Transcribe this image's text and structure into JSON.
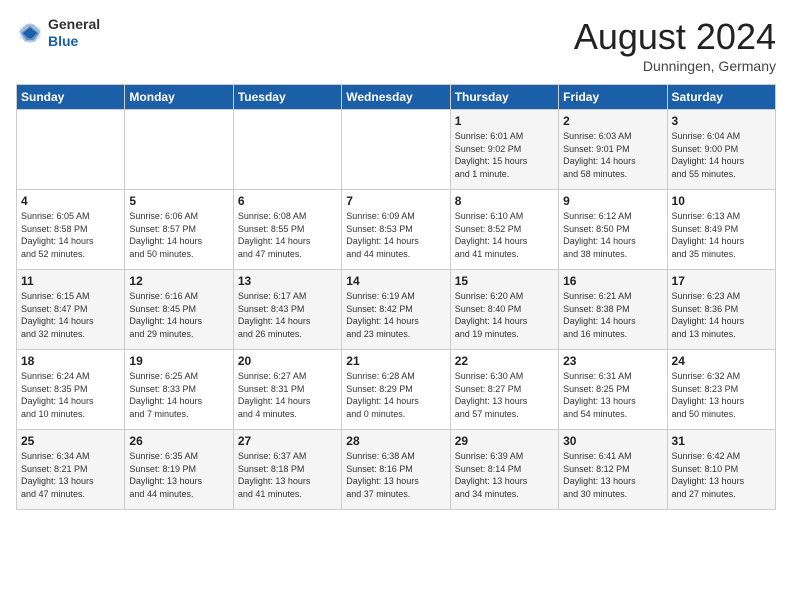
{
  "header": {
    "logo_general": "General",
    "logo_blue": "Blue",
    "title": "August 2024",
    "subtitle": "Dunningen, Germany"
  },
  "weekdays": [
    "Sunday",
    "Monday",
    "Tuesday",
    "Wednesday",
    "Thursday",
    "Friday",
    "Saturday"
  ],
  "weeks": [
    [
      {
        "day": "",
        "info": ""
      },
      {
        "day": "",
        "info": ""
      },
      {
        "day": "",
        "info": ""
      },
      {
        "day": "",
        "info": ""
      },
      {
        "day": "1",
        "info": "Sunrise: 6:01 AM\nSunset: 9:02 PM\nDaylight: 15 hours\nand 1 minute."
      },
      {
        "day": "2",
        "info": "Sunrise: 6:03 AM\nSunset: 9:01 PM\nDaylight: 14 hours\nand 58 minutes."
      },
      {
        "day": "3",
        "info": "Sunrise: 6:04 AM\nSunset: 9:00 PM\nDaylight: 14 hours\nand 55 minutes."
      }
    ],
    [
      {
        "day": "4",
        "info": "Sunrise: 6:05 AM\nSunset: 8:58 PM\nDaylight: 14 hours\nand 52 minutes."
      },
      {
        "day": "5",
        "info": "Sunrise: 6:06 AM\nSunset: 8:57 PM\nDaylight: 14 hours\nand 50 minutes."
      },
      {
        "day": "6",
        "info": "Sunrise: 6:08 AM\nSunset: 8:55 PM\nDaylight: 14 hours\nand 47 minutes."
      },
      {
        "day": "7",
        "info": "Sunrise: 6:09 AM\nSunset: 8:53 PM\nDaylight: 14 hours\nand 44 minutes."
      },
      {
        "day": "8",
        "info": "Sunrise: 6:10 AM\nSunset: 8:52 PM\nDaylight: 14 hours\nand 41 minutes."
      },
      {
        "day": "9",
        "info": "Sunrise: 6:12 AM\nSunset: 8:50 PM\nDaylight: 14 hours\nand 38 minutes."
      },
      {
        "day": "10",
        "info": "Sunrise: 6:13 AM\nSunset: 8:49 PM\nDaylight: 14 hours\nand 35 minutes."
      }
    ],
    [
      {
        "day": "11",
        "info": "Sunrise: 6:15 AM\nSunset: 8:47 PM\nDaylight: 14 hours\nand 32 minutes."
      },
      {
        "day": "12",
        "info": "Sunrise: 6:16 AM\nSunset: 8:45 PM\nDaylight: 14 hours\nand 29 minutes."
      },
      {
        "day": "13",
        "info": "Sunrise: 6:17 AM\nSunset: 8:43 PM\nDaylight: 14 hours\nand 26 minutes."
      },
      {
        "day": "14",
        "info": "Sunrise: 6:19 AM\nSunset: 8:42 PM\nDaylight: 14 hours\nand 23 minutes."
      },
      {
        "day": "15",
        "info": "Sunrise: 6:20 AM\nSunset: 8:40 PM\nDaylight: 14 hours\nand 19 minutes."
      },
      {
        "day": "16",
        "info": "Sunrise: 6:21 AM\nSunset: 8:38 PM\nDaylight: 14 hours\nand 16 minutes."
      },
      {
        "day": "17",
        "info": "Sunrise: 6:23 AM\nSunset: 8:36 PM\nDaylight: 14 hours\nand 13 minutes."
      }
    ],
    [
      {
        "day": "18",
        "info": "Sunrise: 6:24 AM\nSunset: 8:35 PM\nDaylight: 14 hours\nand 10 minutes."
      },
      {
        "day": "19",
        "info": "Sunrise: 6:25 AM\nSunset: 8:33 PM\nDaylight: 14 hours\nand 7 minutes."
      },
      {
        "day": "20",
        "info": "Sunrise: 6:27 AM\nSunset: 8:31 PM\nDaylight: 14 hours\nand 4 minutes."
      },
      {
        "day": "21",
        "info": "Sunrise: 6:28 AM\nSunset: 8:29 PM\nDaylight: 14 hours\nand 0 minutes."
      },
      {
        "day": "22",
        "info": "Sunrise: 6:30 AM\nSunset: 8:27 PM\nDaylight: 13 hours\nand 57 minutes."
      },
      {
        "day": "23",
        "info": "Sunrise: 6:31 AM\nSunset: 8:25 PM\nDaylight: 13 hours\nand 54 minutes."
      },
      {
        "day": "24",
        "info": "Sunrise: 6:32 AM\nSunset: 8:23 PM\nDaylight: 13 hours\nand 50 minutes."
      }
    ],
    [
      {
        "day": "25",
        "info": "Sunrise: 6:34 AM\nSunset: 8:21 PM\nDaylight: 13 hours\nand 47 minutes."
      },
      {
        "day": "26",
        "info": "Sunrise: 6:35 AM\nSunset: 8:19 PM\nDaylight: 13 hours\nand 44 minutes."
      },
      {
        "day": "27",
        "info": "Sunrise: 6:37 AM\nSunset: 8:18 PM\nDaylight: 13 hours\nand 41 minutes."
      },
      {
        "day": "28",
        "info": "Sunrise: 6:38 AM\nSunset: 8:16 PM\nDaylight: 13 hours\nand 37 minutes."
      },
      {
        "day": "29",
        "info": "Sunrise: 6:39 AM\nSunset: 8:14 PM\nDaylight: 13 hours\nand 34 minutes."
      },
      {
        "day": "30",
        "info": "Sunrise: 6:41 AM\nSunset: 8:12 PM\nDaylight: 13 hours\nand 30 minutes."
      },
      {
        "day": "31",
        "info": "Sunrise: 6:42 AM\nSunset: 8:10 PM\nDaylight: 13 hours\nand 27 minutes."
      }
    ]
  ]
}
